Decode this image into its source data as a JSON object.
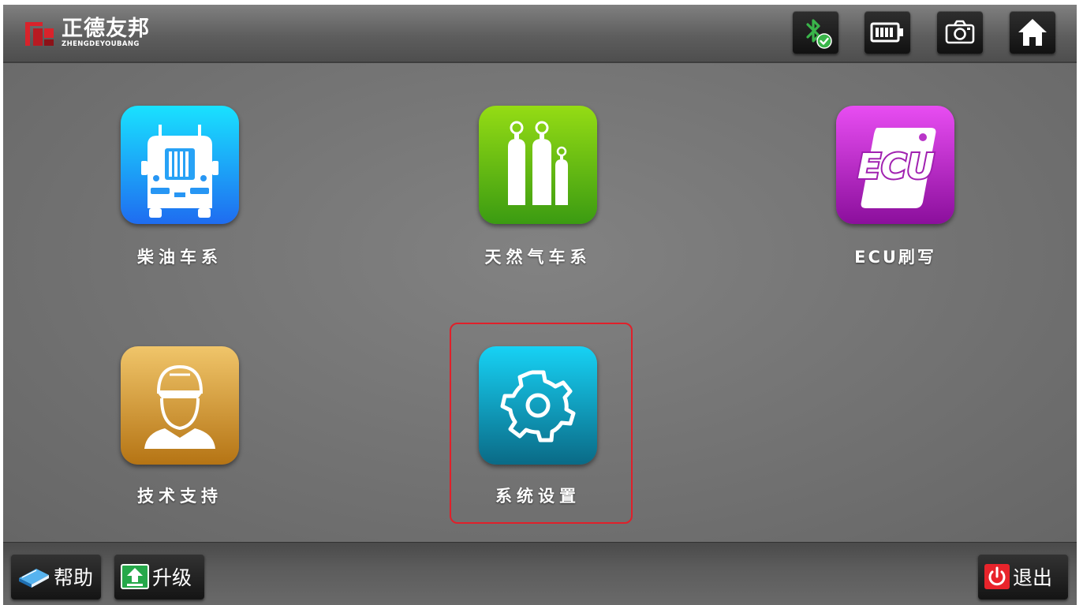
{
  "brand": {
    "name_cn": "正德友邦",
    "name_en": "ZHENGDEYOUBANG",
    "color": "#d9232b"
  },
  "topbar": {
    "icons": [
      "bluetooth-connected-icon",
      "battery-icon",
      "camera-icon",
      "home-icon"
    ],
    "accent": "#3ab54a"
  },
  "apps": [
    {
      "label": "柴油车系",
      "icon": "truck-icon",
      "colors": [
        "#19e2ff",
        "#1f6cf0"
      ]
    },
    {
      "label": "天然气车系",
      "icon": "gas-cylinders-icon",
      "colors": [
        "#95dc14",
        "#3b9b12"
      ]
    },
    {
      "label": "ECU刷写",
      "icon": "ecu-icon",
      "colors": [
        "#e84df2",
        "#8b0f9c"
      ],
      "icon_text": "ECU"
    },
    {
      "label": "技术支持",
      "icon": "technician-icon",
      "colors": [
        "#f0c56a",
        "#b57414"
      ]
    },
    {
      "label": "系统设置",
      "icon": "gear-icon",
      "colors": [
        "#17d2f5",
        "#0a6a86"
      ],
      "selected": true
    }
  ],
  "bottombar": {
    "help_label": "帮助",
    "upgrade_label": "升级",
    "exit_label": "退出"
  }
}
